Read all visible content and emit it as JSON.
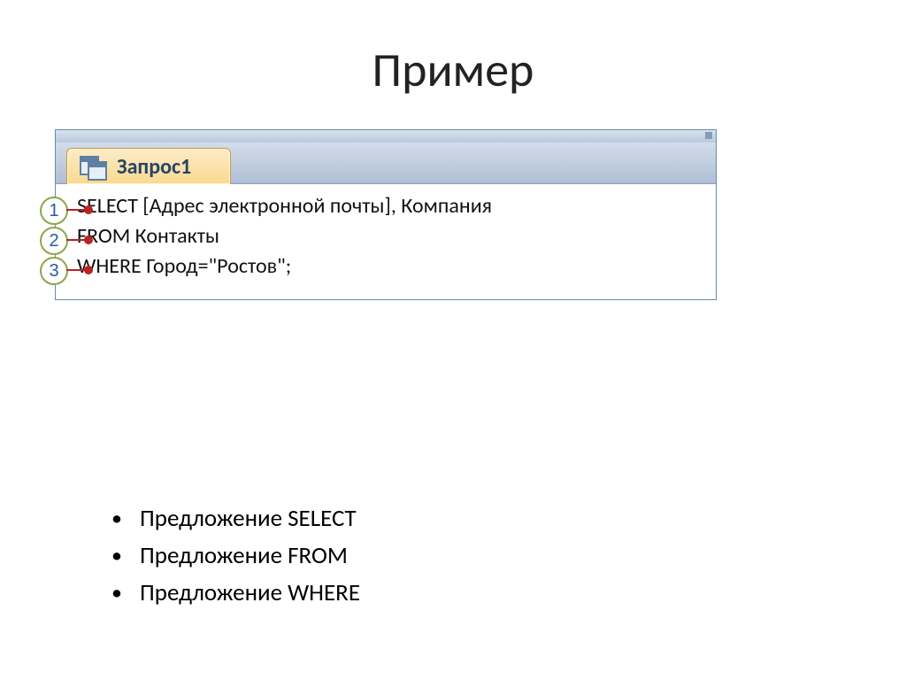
{
  "title": "Пример",
  "tab": {
    "label": "Запрос1"
  },
  "sql": {
    "line1": "SELECT [Адрес электронной почты], Компания",
    "line2": "FROM Контакты",
    "line3": "WHERE Город=\"Ростов\";"
  },
  "callouts": [
    "1",
    "2",
    "3"
  ],
  "bullets": [
    "Предложение SELECT",
    "Предложение FROM",
    "Предложение WHERE"
  ]
}
